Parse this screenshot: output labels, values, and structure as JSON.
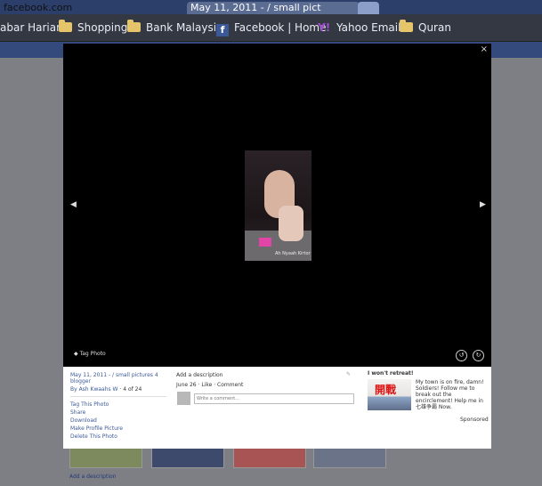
{
  "browser": {
    "tabs": [
      "facebook.com",
      "May 11, 2011 - / small pict",
      ""
    ],
    "bookmarks": [
      {
        "label": "abar Harian",
        "icon": "none"
      },
      {
        "label": "Shopping",
        "icon": "folder-icon"
      },
      {
        "label": "Bank Malaysia",
        "icon": "folder-icon"
      },
      {
        "label": "Facebook | Home",
        "icon": "facebook-icon"
      },
      {
        "label": "Yahoo Email",
        "icon": "yahoo-icon"
      },
      {
        "label": "Quran",
        "icon": "folder-icon"
      }
    ]
  },
  "lightbox": {
    "close_label": "×",
    "photo_caption": "Ah Nyaah Kirtor",
    "prev_arrow": "◀",
    "next_arrow": "▶",
    "tag_photo_label": "Tag Photo",
    "rotate_left": "↺",
    "rotate_right": "↻"
  },
  "info": {
    "title": "May 11, 2011 - / small pictures 4 blogger",
    "by_label": "By Ash Kwaahs W",
    "position": "4 of 24",
    "actions": [
      "Tag This Photo",
      "Share",
      "Download",
      "Make Profile Picture",
      "Delete This Photo"
    ],
    "add_description": "Add a description",
    "meta": "June 26 · Like · Comment",
    "comment_placeholder": "Write a comment...",
    "ad_title": "I won't retreat!",
    "ad_image_text": "開戰",
    "ad_body": "My town is on fire, damn! Soldiers! Follow me to break out the encirclement! Help me in 七雄争霸 Now.",
    "sponsored": "Sponsored"
  },
  "background": {
    "add_description": "Add a description"
  },
  "colors": {
    "fb_blue": "#3b5998",
    "lightbox_bg": "#000000",
    "info_bg": "#ffffff"
  }
}
